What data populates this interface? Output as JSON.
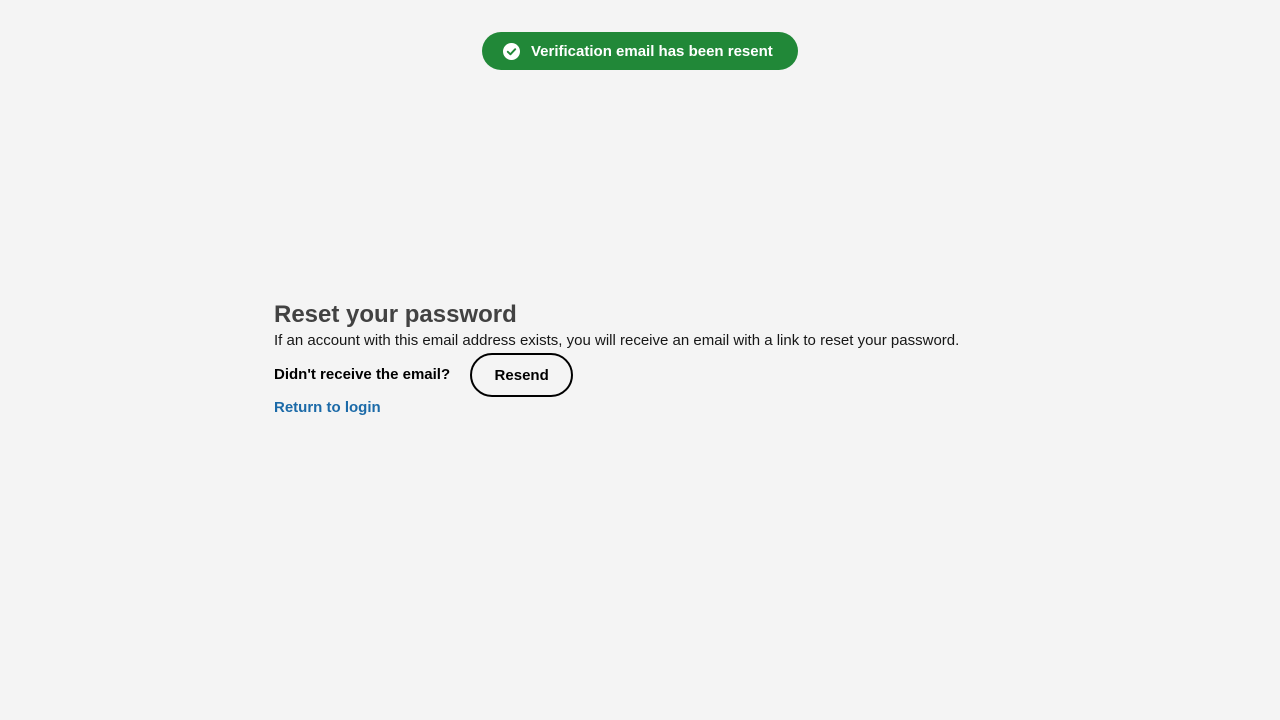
{
  "toast": {
    "icon": "check-circle-icon",
    "message": "Verification email has been resent",
    "color": "#218838"
  },
  "main": {
    "title": "Reset your password",
    "description": "If an account with this email address exists, you will receive an email with a link to reset your password.",
    "resend_prompt": "Didn't receive the email?",
    "resend_label": "Resend",
    "return_link": "Return to login",
    "link_color": "#1b6aa8"
  }
}
